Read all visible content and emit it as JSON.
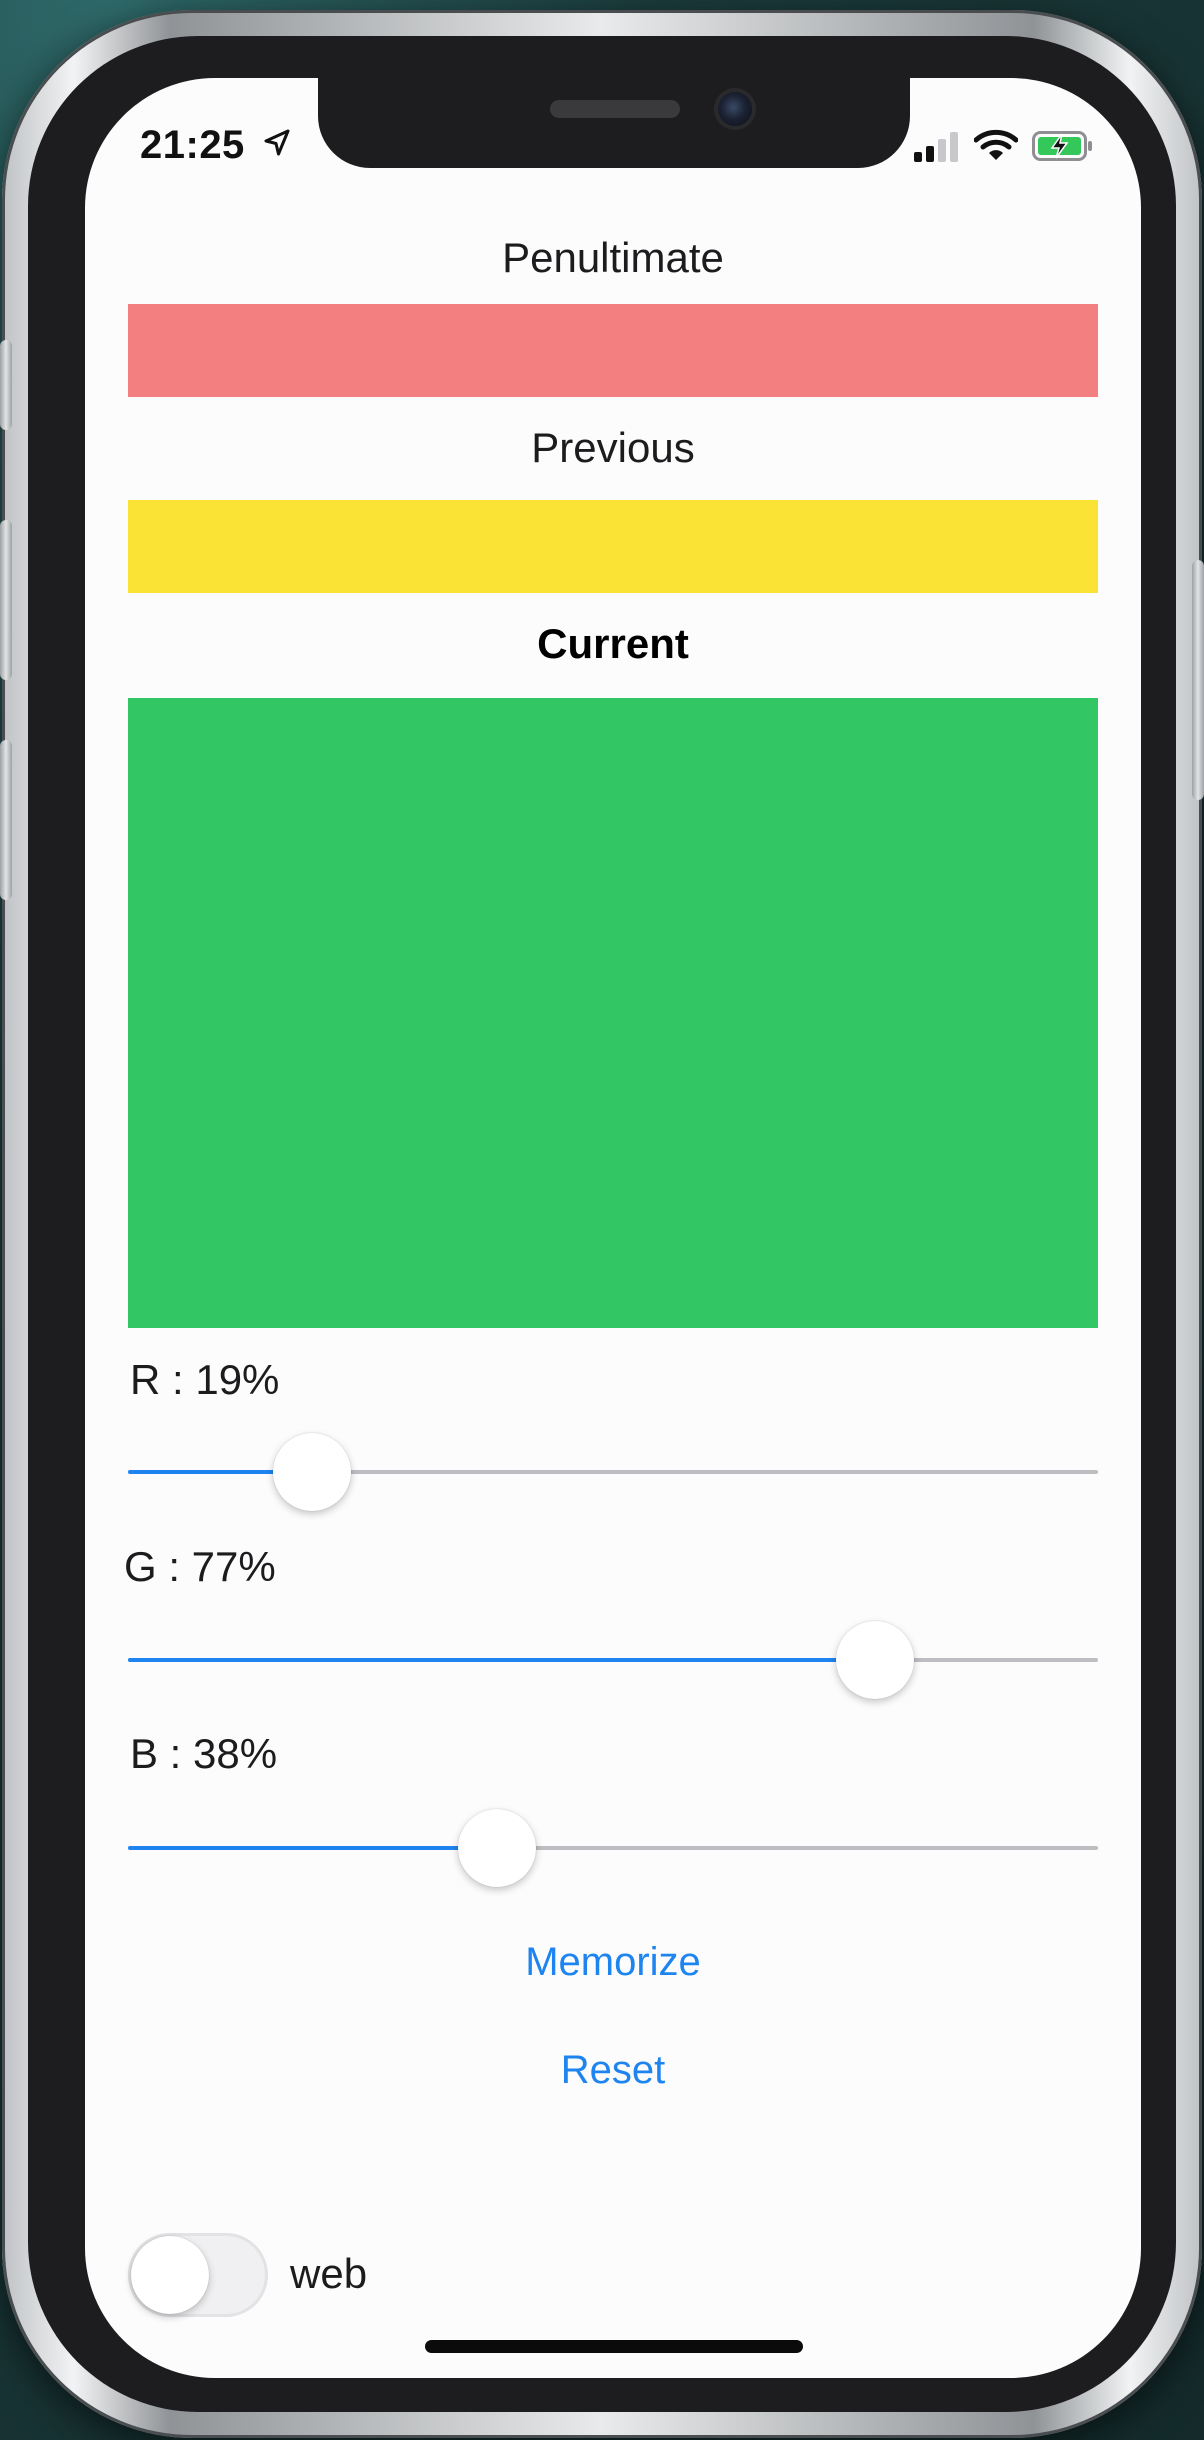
{
  "status_bar": {
    "time": "21:25",
    "icons": [
      "location-arrow-icon",
      "cellular-signal-icon",
      "wifi-icon",
      "battery-charging-icon"
    ]
  },
  "colors": {
    "penultimate": "#f47f80",
    "previous": "#fae334",
    "current": "#32c764",
    "slider_fill": "#1e84f0",
    "slider_track": "#bdbdc2",
    "link": "#1e84f0"
  },
  "swatches": {
    "penultimate_label": "Penultimate",
    "previous_label": "Previous",
    "current_label": "Current"
  },
  "sliders": [
    {
      "label": "R : 19%",
      "value_percent": 19
    },
    {
      "label": "G : 77%",
      "value_percent": 77
    },
    {
      "label": "B : 38%",
      "value_percent": 38
    }
  ],
  "actions": {
    "memorize_label": "Memorize",
    "reset_label": "Reset"
  },
  "toggle": {
    "label": "web",
    "on": false
  }
}
